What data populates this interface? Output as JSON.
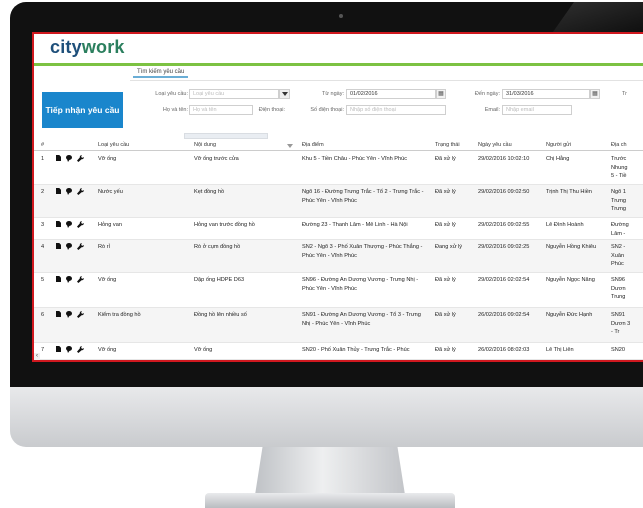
{
  "app": {
    "logo_city": "city",
    "logo_work": "work"
  },
  "tabs": {
    "search": "Tìm kiếm yêu cầu"
  },
  "actions": {
    "receive": "Tiếp nhận yêu cầu"
  },
  "form": {
    "type_label": "Loại yêu cầu:",
    "type_placeholder": "Loại yêu cầu",
    "fullname_label": "Họ và tên:",
    "fullname_placeholder": "Họ và tên",
    "phone_label": "Điện thoại:",
    "from_label": "Từ ngày:",
    "from_value": "01/02/2016",
    "phone_number_label": "Số điện thoại:",
    "phone_number_placeholder": "Nhập số điện thoại",
    "to_label": "Đến ngày:",
    "to_value": "31/03/2016",
    "email_label": "Email:",
    "email_placeholder": "Nhập email",
    "extra_label": "Tr"
  },
  "table": {
    "headers": [
      "#",
      "Loại yêu cầu",
      "Nội dung",
      "Địa điểm",
      "Trạng thái",
      "Ngày yêu cầu",
      "Người gửi",
      "Địa ch"
    ],
    "rows": [
      {
        "n": "1",
        "type": "Vỡ ống",
        "content": "Vỡ ống trước cửa",
        "place": "Khu 5 - Tiền Châu - Phúc Yên - Vĩnh Phúc",
        "status": "Đã xử lý",
        "date": "29/02/2016 10:02:10",
        "sender": "Chị Hằng",
        "addr": "Trước Nhung 5 - Tiề"
      },
      {
        "n": "2",
        "type": "Nước yếu",
        "content": "Kẹt đồng hồ",
        "place": "Ngõ 16 - Đường Trưng Trắc - Tổ 2 - Trưng Trắc - Phúc Yên - Vĩnh Phúc",
        "status": "Đã xử lý",
        "date": "29/02/2016 09:02:50",
        "sender": "Trịnh Thị Thu Hiền",
        "addr": "Ngõ 1 Trưng Trưng"
      },
      {
        "n": "3",
        "type": "Hỏng van",
        "content": "Hỏng van trước đồng hồ",
        "place": "Đường 23 - Thanh Lâm - Mê Linh - Hà Nội",
        "status": "Đã xử lý",
        "date": "29/02/2016 09:02:55",
        "sender": "Lê Đình Hoành",
        "addr": "Đường Lâm -"
      },
      {
        "n": "4",
        "type": "Rò rỉ",
        "content": "Rò ở cụm đồng hồ",
        "place": "SN2 - Ngõ 3 - Phố Xuân Thượng - Phúc Thắng - Phúc Yên - Vĩnh Phúc",
        "status": "Đang xử lý",
        "date": "29/02/2016 09:02:25",
        "sender": "Nguyễn Hồng Khiêu",
        "addr": "SN2 - Xuân Phúc"
      },
      {
        "n": "5",
        "type": "Vỡ ống",
        "content": "Dập ống HDPE D63",
        "place": "SN96 - Đường An Dương Vương - Trưng Nhị - Phúc Yên - Vĩnh Phúc",
        "status": "Đã xử lý",
        "date": "29/02/2016 02:02:54",
        "sender": "Nguyễn Ngọc Năng",
        "addr": "SN96 Dươn Trung"
      },
      {
        "n": "6",
        "type": "Kiểm tra đồng hồ",
        "content": "Đồng hồ lên nhiều số",
        "place": "SN91 - Đường An Dương Vương - Tổ 3 - Trưng Nhị - Phúc Yên - Vĩnh Phúc",
        "status": "Đã xử lý",
        "date": "26/02/2016 09:02:54",
        "sender": "Nguyễn Đức Hạnh",
        "addr": "SN91 Dươn 3 - Tr"
      },
      {
        "n": "7",
        "type": "Vỡ ống",
        "content": "Vỡ ống",
        "place": "SN20 - Phố Xuân Thủy - Trưng Trắc - Phúc",
        "status": "Đã xử lý",
        "date": "26/02/2016 08:02:03",
        "sender": "Lê Thị Liên",
        "addr": "SN20"
      }
    ]
  },
  "icons": [
    "document-icon",
    "comment-icon",
    "wrench-icon",
    "calendar-icon",
    "chevron-down-icon",
    "sort-down-icon",
    "scroll-left-icon"
  ],
  "colors": {
    "brand_green": "#2b7f5e",
    "accent_blue": "#1a86cc",
    "frame_red": "#d0181f",
    "topline_green": "#7cc242"
  }
}
